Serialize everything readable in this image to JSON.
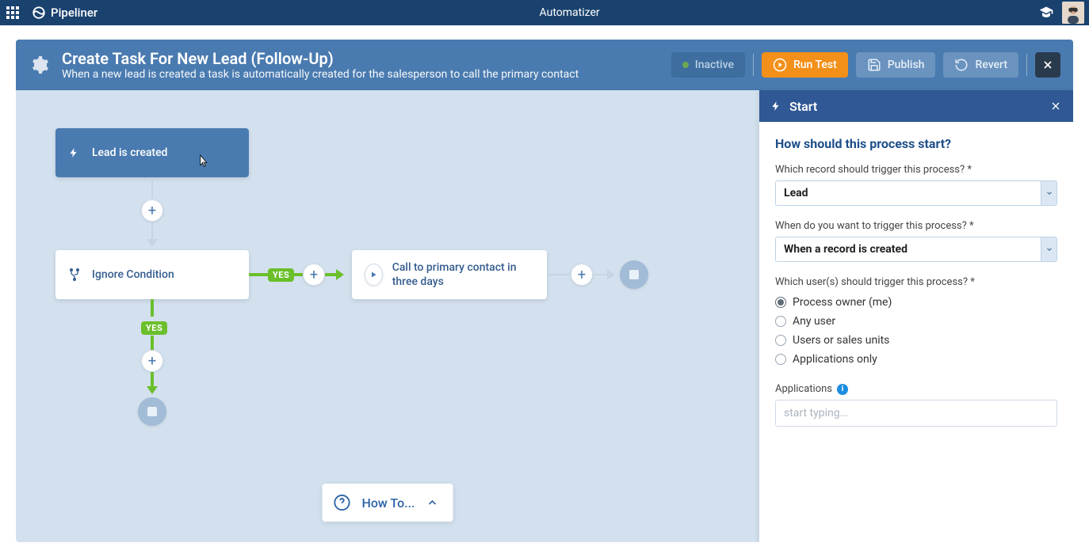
{
  "topbar": {
    "app_name": "Pipeliner",
    "module_name": "Automatizer"
  },
  "header": {
    "title": "Create Task For New Lead (Follow-Up)",
    "subtitle": "When a new lead is created a task is automatically created for the salesperson to call the primary contact",
    "status_text": "Inactive",
    "run_test": "Run Test",
    "publish": "Publish",
    "revert": "Revert"
  },
  "flow": {
    "trigger_label": "Lead is created",
    "condition_label": "Ignore Condition",
    "action_label": "Call to primary contact in three days",
    "yes_badge": "YES"
  },
  "howto": "How To...",
  "panel": {
    "title": "Start",
    "question": "How should this process start?",
    "record_label": "Which record should trigger this process? *",
    "record_value": "Lead",
    "when_label": "When do you want to trigger this process? *",
    "when_value": "When a record is created",
    "user_label": "Which user(s) should trigger this process? *",
    "user_options": {
      "owner": "Process owner (me)",
      "any": "Any user",
      "sales": "Users or sales units",
      "apps": "Applications only"
    },
    "apps_label": "Applications",
    "apps_placeholder": "start typing..."
  }
}
